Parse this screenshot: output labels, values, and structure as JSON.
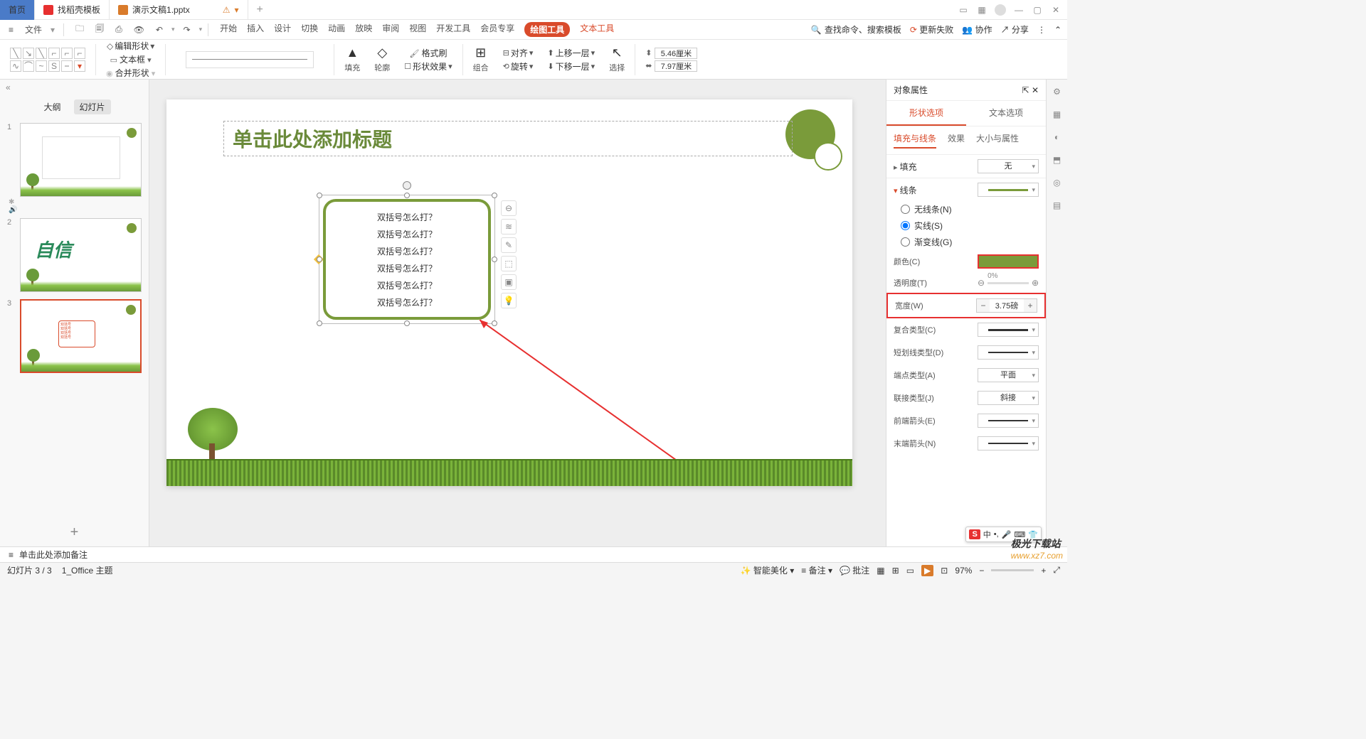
{
  "titlebar": {
    "tabs": [
      {
        "label": "首页",
        "home": true
      },
      {
        "label": "找稻壳模板"
      },
      {
        "label": "演示文稿1.pptx",
        "active": true
      }
    ],
    "warn_icon": "⚠"
  },
  "menubar": {
    "file": "文件",
    "tabs": [
      "开始",
      "插入",
      "设计",
      "切换",
      "动画",
      "放映",
      "审阅",
      "视图",
      "开发工具",
      "会员专享",
      "绘图工具",
      "文本工具"
    ],
    "active_tab": "绘图工具",
    "extra_tab": "文本工具",
    "search_ph": "查找命令、搜索模板",
    "right": {
      "update": "更新失败",
      "coop": "协作",
      "share": "分享"
    }
  },
  "ribbon": {
    "edit_shape": "编辑形状",
    "textbox": "文本框",
    "merge": "合并形状",
    "fill": "填充",
    "outline": "轮廓",
    "effect": "形状效果",
    "fmt": "格式刷",
    "group": "组合",
    "align": "对齐",
    "rotate": "旋转",
    "up": "上移一层",
    "down": "下移一层",
    "select": "选择",
    "w": "5.46厘米",
    "h": "7.97厘米"
  },
  "sidebar": {
    "tabs": [
      "大纲",
      "幻灯片"
    ],
    "active": "幻灯片",
    "slides": [
      "1",
      "2",
      "3"
    ],
    "t2": "自信"
  },
  "slide": {
    "title_ph": "单击此处添加标题",
    "lines": [
      "双括号怎么打？",
      "双括号怎么打？",
      "双括号怎么打？",
      "双括号怎么打？",
      "双括号怎么打？",
      "双括号怎么打？"
    ]
  },
  "notes": {
    "ph": "单击此处添加备注"
  },
  "panel": {
    "title": "对象属性",
    "tabs": [
      "形状选项",
      "文本选项"
    ],
    "active": "形状选项",
    "sub": [
      "填充与线条",
      "效果",
      "大小与属性"
    ],
    "sub_active": "填充与线条",
    "fill_h": "填充",
    "fill_val": "无",
    "line_h": "线条",
    "radios": [
      "无线条(N)",
      "实线(S)",
      "渐变线(G)"
    ],
    "radio_sel": 1,
    "color": "颜色(C)",
    "color_val": "#7a9b3a",
    "trans": "透明度(T)",
    "trans_val": "0%",
    "width": "宽度(W)",
    "width_val": "3.75磅",
    "compound": "复合类型(C)",
    "dash": "短划线类型(D)",
    "cap": "端点类型(A)",
    "cap_val": "平面",
    "join": "联接类型(J)",
    "join_val": "斜接",
    "arrow1": "前端箭头(E)",
    "arrow2": "末端箭头(N)"
  },
  "status": {
    "slide": "幻灯片 3 / 3",
    "theme": "1_Office 主题",
    "beautify": "智能美化",
    "notes": "备注",
    "comments": "批注",
    "zoom": "97%"
  },
  "ime": {
    "s": "S",
    "zh": "中"
  },
  "watermark": {
    "t1": "极光下载站",
    "t2": "www.xz7.com"
  }
}
